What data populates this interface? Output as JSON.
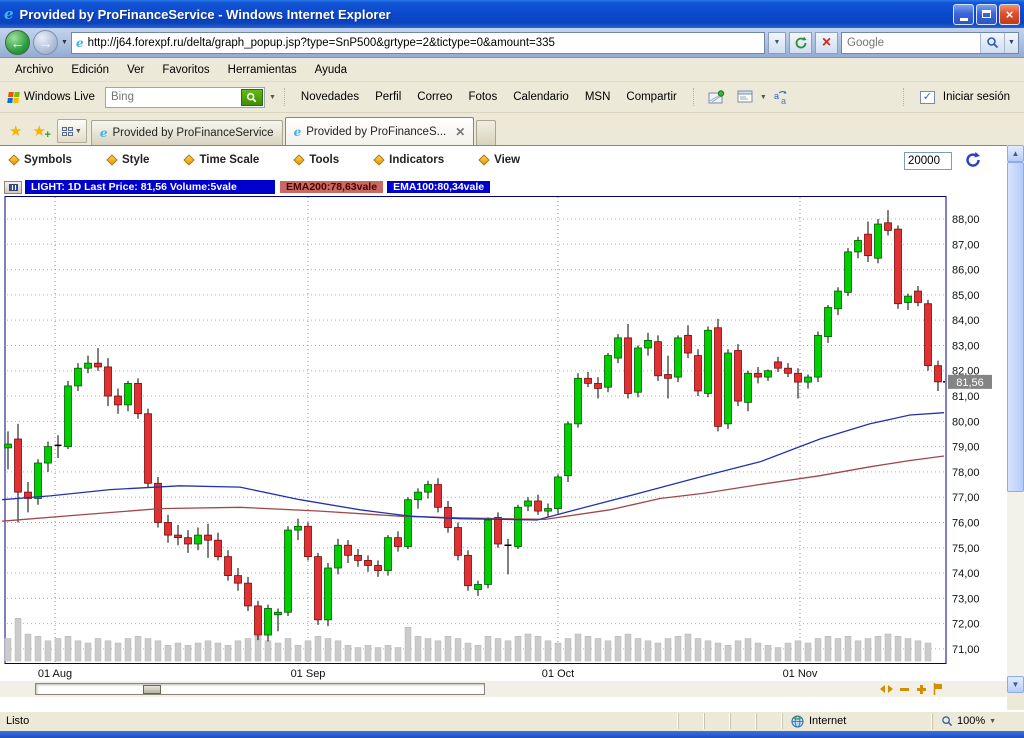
{
  "window": {
    "title": "Provided by ProFinanceService - Windows Internet Explorer"
  },
  "nav": {
    "url": "http://j64.forexpf.ru/delta/graph_popup.jsp?type=SnP500&grtype=2&tictype=0&amount=335",
    "search_placeholder": "Google"
  },
  "menu": {
    "items": [
      "Archivo",
      "Edición",
      "Ver",
      "Favoritos",
      "Herramientas",
      "Ayuda"
    ]
  },
  "live_toolbar": {
    "brand": "Windows Live",
    "search_placeholder": "Bing",
    "links": [
      "Novedades",
      "Perfil",
      "Correo",
      "Fotos",
      "Calendario",
      "MSN",
      "Compartir"
    ],
    "signin_label": "Iniciar sesión"
  },
  "tabs": {
    "items": [
      {
        "label": "Provided by ProFinanceService",
        "active": false
      },
      {
        "label": "Provided by ProFinanceS...",
        "active": true
      }
    ]
  },
  "chart_toolbar": {
    "menus": [
      "Symbols",
      "Style",
      "Time Scale",
      "Tools",
      "Indicators",
      "View"
    ],
    "amount_value": "20000"
  },
  "legend": {
    "main": "LIGHT: 1D Last Price: 81,56 Volume:5vale",
    "ema200": "EMA200:78,63vale",
    "ema100": "EMA100:80,34vale"
  },
  "status_bar": {
    "text": "Listo",
    "zone": "Internet",
    "zoom": "100%"
  },
  "chart_data": {
    "type": "candlestick",
    "symbol": "LIGHT 1D",
    "ylim": [
      71,
      88
    ],
    "y_ticks": [
      "88,00",
      "87,00",
      "86,00",
      "85,00",
      "84,00",
      "83,00",
      "82,00",
      "81,00",
      "80,00",
      "79,00",
      "78,00",
      "77,00",
      "76,00",
      "75,00",
      "74,00",
      "73,00",
      "72,00",
      "71,00"
    ],
    "x_axis": [
      {
        "label": "01 Aug",
        "index": 4.7
      },
      {
        "label": "01 Sep",
        "index": 30
      },
      {
        "label": "01 Oct",
        "index": 55
      },
      {
        "label": "01 Nov",
        "index": 79.2
      }
    ],
    "last_price": 81.56,
    "last_price_label": "81,56",
    "indicators": [
      {
        "name": "EMA200",
        "value": 78.63
      },
      {
        "name": "EMA100",
        "value": 80.34
      }
    ],
    "colors": {
      "up": "#00cf00",
      "up_edge": "#015c01",
      "down": "#e03232",
      "down_edge": "#7a0a0a",
      "ema100": "#2233aa",
      "ema200": "#a04848",
      "volume": "#cbcbcb",
      "border": "#000080",
      "marker": "#848484",
      "grid": "#b0b0b0"
    },
    "candles": [
      [
        78.95,
        79.6,
        78.1,
        79.1
      ],
      [
        79.3,
        79.9,
        76.0,
        77.2
      ],
      [
        77.2,
        77.6,
        76.4,
        76.95
      ],
      [
        76.95,
        78.5,
        76.7,
        78.35
      ],
      [
        78.35,
        79.2,
        78.0,
        79.0
      ],
      [
        79.0,
        79.45,
        78.55,
        79.05
      ],
      [
        79.0,
        81.6,
        78.9,
        81.4
      ],
      [
        81.4,
        82.3,
        81.2,
        82.1
      ],
      [
        82.1,
        82.6,
        81.9,
        82.3
      ],
      [
        82.3,
        82.9,
        82.0,
        82.15
      ],
      [
        82.15,
        82.5,
        80.6,
        81.0
      ],
      [
        81.0,
        81.3,
        80.3,
        80.65
      ],
      [
        80.65,
        81.6,
        80.4,
        81.5
      ],
      [
        81.5,
        81.7,
        80.1,
        80.3
      ],
      [
        80.3,
        80.5,
        77.4,
        77.55
      ],
      [
        77.55,
        77.8,
        75.8,
        76.0
      ],
      [
        76.0,
        76.3,
        75.2,
        75.5
      ],
      [
        75.5,
        75.9,
        75.1,
        75.4
      ],
      [
        75.4,
        75.7,
        74.8,
        75.15
      ],
      [
        75.15,
        75.8,
        74.9,
        75.5
      ],
      [
        75.5,
        75.95,
        74.6,
        75.3
      ],
      [
        75.3,
        75.6,
        74.5,
        74.65
      ],
      [
        74.65,
        74.9,
        73.7,
        73.9
      ],
      [
        73.9,
        74.2,
        73.3,
        73.6
      ],
      [
        73.6,
        73.85,
        72.5,
        72.7
      ],
      [
        72.7,
        72.9,
        71.35,
        71.55
      ],
      [
        71.55,
        72.75,
        71.3,
        72.6
      ],
      [
        72.35,
        72.6,
        71.7,
        72.45
      ],
      [
        72.45,
        75.85,
        72.3,
        75.7
      ],
      [
        75.7,
        76.15,
        75.3,
        75.85
      ],
      [
        75.85,
        76.0,
        74.5,
        74.65
      ],
      [
        74.65,
        74.8,
        71.95,
        72.15
      ],
      [
        72.15,
        74.4,
        71.9,
        74.2
      ],
      [
        74.2,
        75.35,
        73.95,
        75.1
      ],
      [
        75.1,
        75.3,
        74.4,
        74.7
      ],
      [
        74.7,
        74.95,
        74.25,
        74.5
      ],
      [
        74.5,
        74.7,
        74.05,
        74.3
      ],
      [
        74.3,
        74.5,
        73.85,
        74.1
      ],
      [
        74.1,
        75.5,
        73.9,
        75.4
      ],
      [
        75.4,
        75.65,
        74.85,
        75.05
      ],
      [
        75.05,
        77.0,
        74.95,
        76.9
      ],
      [
        76.9,
        77.35,
        76.55,
        77.2
      ],
      [
        77.2,
        77.65,
        76.95,
        77.5
      ],
      [
        77.5,
        77.75,
        76.4,
        76.6
      ],
      [
        76.6,
        76.85,
        75.6,
        75.8
      ],
      [
        75.8,
        76.0,
        74.5,
        74.7
      ],
      [
        74.7,
        74.9,
        73.3,
        73.5
      ],
      [
        73.35,
        73.7,
        73.1,
        73.55
      ],
      [
        73.55,
        76.2,
        73.4,
        76.1
      ],
      [
        76.2,
        76.4,
        75.0,
        75.15
      ],
      [
        75.1,
        75.35,
        73.95,
        75.05
      ],
      [
        75.05,
        76.7,
        74.95,
        76.6
      ],
      [
        76.65,
        77.0,
        76.45,
        76.85
      ],
      [
        76.85,
        77.1,
        76.3,
        76.45
      ],
      [
        76.45,
        76.75,
        76.2,
        76.55
      ],
      [
        76.55,
        77.9,
        76.35,
        77.8
      ],
      [
        77.85,
        80.0,
        77.6,
        79.9
      ],
      [
        79.9,
        81.9,
        79.75,
        81.7
      ],
      [
        81.7,
        81.95,
        81.35,
        81.5
      ],
      [
        81.5,
        81.75,
        80.9,
        81.3
      ],
      [
        81.35,
        82.7,
        81.15,
        82.6
      ],
      [
        82.5,
        83.45,
        82.3,
        83.3
      ],
      [
        83.3,
        83.85,
        80.9,
        81.1
      ],
      [
        81.15,
        83.0,
        80.95,
        82.9
      ],
      [
        82.9,
        83.5,
        82.6,
        83.2
      ],
      [
        83.15,
        83.4,
        81.6,
        81.8
      ],
      [
        81.85,
        82.6,
        80.9,
        81.7
      ],
      [
        81.75,
        83.4,
        81.55,
        83.3
      ],
      [
        83.4,
        83.8,
        82.5,
        82.7
      ],
      [
        82.6,
        82.85,
        81.0,
        81.2
      ],
      [
        81.1,
        83.75,
        80.95,
        83.6
      ],
      [
        83.7,
        84.05,
        79.6,
        79.8
      ],
      [
        79.9,
        82.85,
        79.7,
        82.7
      ],
      [
        82.8,
        83.05,
        80.6,
        80.8
      ],
      [
        80.75,
        82.0,
        80.4,
        81.9
      ],
      [
        81.9,
        82.15,
        81.5,
        81.75
      ],
      [
        81.75,
        82.05,
        81.6,
        82.0
      ],
      [
        82.35,
        82.55,
        81.95,
        82.1
      ],
      [
        82.1,
        82.3,
        81.75,
        81.9
      ],
      [
        81.9,
        82.1,
        80.9,
        81.55
      ],
      [
        81.55,
        81.85,
        81.3,
        81.75
      ],
      [
        81.75,
        83.55,
        81.55,
        83.4
      ],
      [
        83.35,
        84.6,
        83.1,
        84.5
      ],
      [
        84.45,
        85.3,
        84.2,
        85.15
      ],
      [
        85.1,
        86.85,
        84.95,
        86.7
      ],
      [
        86.7,
        87.3,
        86.45,
        87.15
      ],
      [
        87.4,
        87.9,
        86.3,
        86.55
      ],
      [
        86.45,
        88.0,
        86.25,
        87.8
      ],
      [
        87.85,
        88.35,
        87.35,
        87.55
      ],
      [
        87.6,
        87.75,
        84.45,
        84.65
      ],
      [
        84.7,
        85.05,
        84.4,
        84.95
      ],
      [
        85.15,
        85.35,
        84.55,
        84.7
      ],
      [
        84.65,
        84.8,
        82.0,
        82.2
      ],
      [
        82.2,
        82.4,
        81.2,
        81.56
      ]
    ],
    "volume": [
      0.5,
      0.95,
      0.6,
      0.55,
      0.45,
      0.5,
      0.55,
      0.45,
      0.4,
      0.5,
      0.45,
      0.4,
      0.5,
      0.55,
      0.5,
      0.45,
      0.35,
      0.4,
      0.35,
      0.4,
      0.45,
      0.4,
      0.35,
      0.45,
      0.5,
      0.55,
      0.45,
      0.4,
      0.5,
      0.35,
      0.45,
      0.55,
      0.5,
      0.45,
      0.35,
      0.3,
      0.35,
      0.3,
      0.35,
      0.3,
      0.75,
      0.55,
      0.5,
      0.45,
      0.55,
      0.5,
      0.4,
      0.35,
      0.55,
      0.5,
      0.45,
      0.55,
      0.6,
      0.55,
      0.45,
      0.4,
      0.5,
      0.6,
      0.55,
      0.5,
      0.45,
      0.55,
      0.6,
      0.5,
      0.45,
      0.4,
      0.5,
      0.55,
      0.6,
      0.5,
      0.45,
      0.4,
      0.35,
      0.45,
      0.5,
      0.4,
      0.35,
      0.3,
      0.4,
      0.45,
      0.4,
      0.5,
      0.55,
      0.5,
      0.55,
      0.45,
      0.5,
      0.55,
      0.6,
      0.55,
      0.5,
      0.45,
      0.4
    ],
    "ema100_points": [
      [
        2,
        76.9
      ],
      [
        50,
        77.05
      ],
      [
        110,
        77.3
      ],
      [
        180,
        77.45
      ],
      [
        240,
        77.4
      ],
      [
        300,
        76.9
      ],
      [
        360,
        76.5
      ],
      [
        410,
        76.25
      ],
      [
        460,
        76.15
      ],
      [
        537,
        76.1
      ],
      [
        580,
        76.55
      ],
      [
        648,
        77.25
      ],
      [
        700,
        77.8
      ],
      [
        760,
        78.4
      ],
      [
        820,
        79.3
      ],
      [
        870,
        79.9
      ],
      [
        910,
        80.25
      ],
      [
        944,
        80.34
      ]
    ],
    "ema200_points": [
      [
        2,
        76.05
      ],
      [
        80,
        76.3
      ],
      [
        160,
        76.55
      ],
      [
        240,
        76.6
      ],
      [
        320,
        76.45
      ],
      [
        400,
        76.25
      ],
      [
        460,
        76.18
      ],
      [
        545,
        76.12
      ],
      [
        610,
        76.5
      ],
      [
        660,
        76.95
      ],
      [
        703,
        77.15
      ],
      [
        760,
        77.5
      ],
      [
        820,
        77.85
      ],
      [
        870,
        78.2
      ],
      [
        910,
        78.45
      ],
      [
        944,
        78.63
      ]
    ]
  }
}
